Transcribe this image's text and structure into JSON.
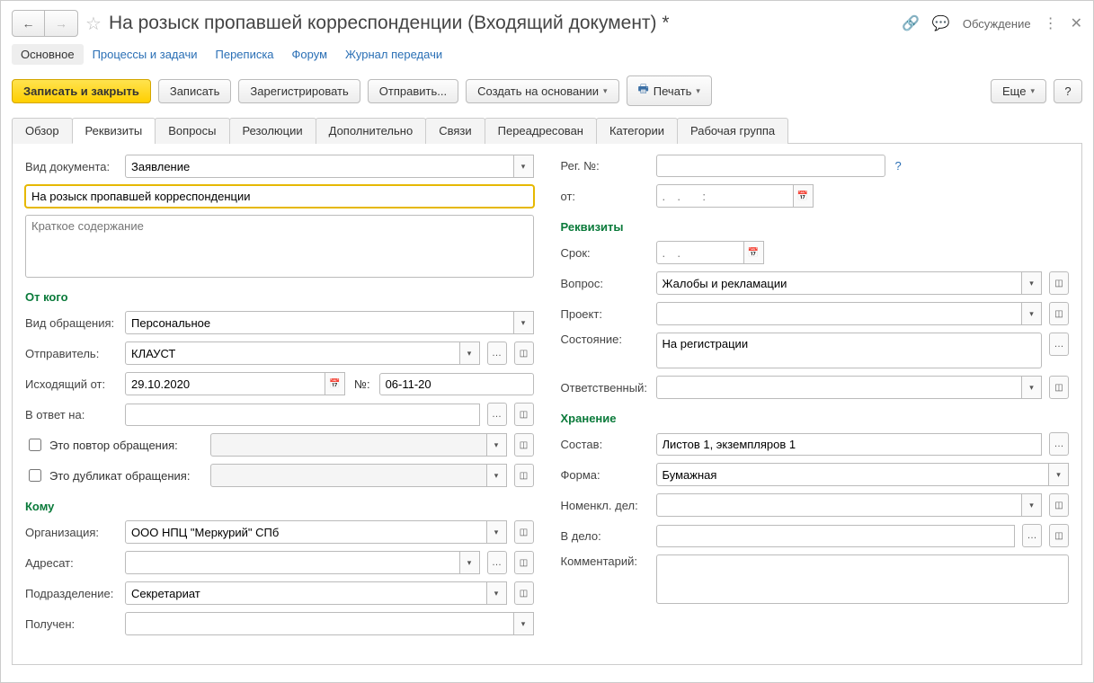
{
  "title": "На розыск пропавшей корреспонденции (Входящий документ) *",
  "discuss": "Обсуждение",
  "nav": {
    "main": "Основное",
    "proc": "Процессы и задачи",
    "corr": "Переписка",
    "forum": "Форум",
    "journal": "Журнал передачи"
  },
  "toolbar": {
    "save_close": "Записать и закрыть",
    "save": "Записать",
    "register": "Зарегистрировать",
    "send": "Отправить...",
    "create_based": "Создать на основании",
    "print": "Печать",
    "more": "Еще",
    "help": "?"
  },
  "tabs": {
    "overview": "Обзор",
    "props": "Реквизиты",
    "questions": "Вопросы",
    "resolutions": "Резолюции",
    "extra": "Дополнительно",
    "links": "Связи",
    "redirected": "Переадресован",
    "categories": "Категории",
    "workgroup": "Рабочая группа"
  },
  "left": {
    "doc_type_lbl": "Вид документа:",
    "doc_type": "Заявление",
    "subject": "На розыск пропавшей корреспонденции",
    "summary_ph": "Краткое содержание",
    "from_grp": "От кого",
    "appeal_type_lbl": "Вид обращения:",
    "appeal_type": "Персональное",
    "sender_lbl": "Отправитель:",
    "sender": "КЛАУСТ",
    "outgoing_lbl": "Исходящий от:",
    "outgoing_date": "29.10.2020",
    "num_lbl": "№:",
    "num": "06-11-20",
    "reply_lbl": "В ответ на:",
    "repeat_lbl": "Это повтор обращения:",
    "duplicate_lbl": "Это дубликат обращения:",
    "to_grp": "Кому",
    "org_lbl": "Организация:",
    "org": "ООО НПЦ \"Меркурий\" СПб",
    "addressee_lbl": "Адресат:",
    "dept_lbl": "Подразделение:",
    "dept": "Секретариат",
    "received_lbl": "Получен:"
  },
  "right": {
    "regno_lbl": "Рег. №:",
    "from_lbl": "от:",
    "date_ph": ".  .    :",
    "props_grp": "Реквизиты",
    "term_lbl": "Срок:",
    "term_ph": ".  .",
    "question_lbl": "Вопрос:",
    "question": "Жалобы и рекламации",
    "project_lbl": "Проект:",
    "state_lbl": "Состояние:",
    "state": "На регистрации",
    "resp_lbl": "Ответственный:",
    "store_grp": "Хранение",
    "compose_lbl": "Состав:",
    "compose": "Листов 1, экземпляров 1",
    "form_lbl": "Форма:",
    "form": "Бумажная",
    "nomen_lbl": "Номенкл. дел:",
    "tofile_lbl": "В дело:",
    "comment_lbl": "Комментарий:"
  }
}
